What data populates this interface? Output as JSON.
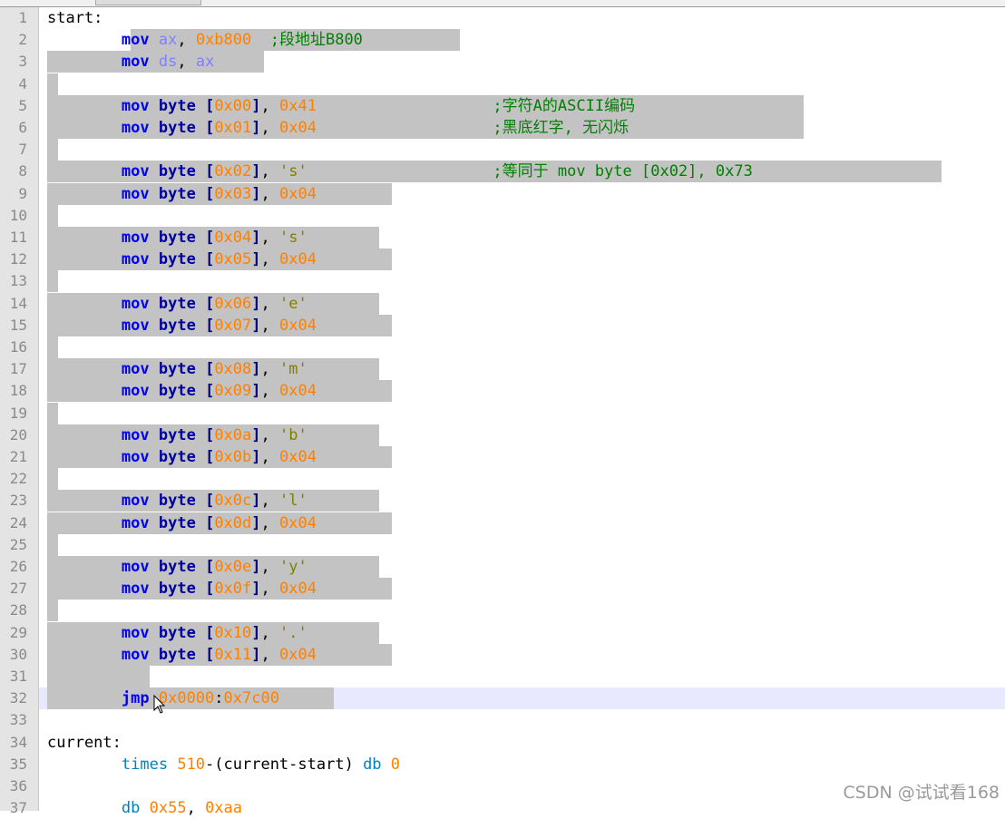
{
  "editor": {
    "lines": [
      {
        "n": "1",
        "tokens": [
          [
            "lbl",
            "start:"
          ]
        ]
      },
      {
        "n": "2",
        "tokens": [
          [
            "sp",
            "        "
          ],
          [
            "kw",
            "mov"
          ],
          [
            "sp",
            " "
          ],
          [
            "reg",
            "ax"
          ],
          [
            "plain",
            ", "
          ],
          [
            "num",
            "0xb800"
          ],
          [
            "sp",
            "  "
          ],
          [
            "cm",
            ";段地址B800"
          ]
        ]
      },
      {
        "n": "3",
        "tokens": [
          [
            "sp",
            "        "
          ],
          [
            "kw",
            "mov"
          ],
          [
            "sp",
            " "
          ],
          [
            "reg",
            "ds"
          ],
          [
            "plain",
            ", "
          ],
          [
            "reg",
            "ax"
          ]
        ]
      },
      {
        "n": "4",
        "tokens": []
      },
      {
        "n": "5",
        "tokens": [
          [
            "sp",
            "        "
          ],
          [
            "kw",
            "mov"
          ],
          [
            "sp",
            " "
          ],
          [
            "kw2",
            "byte"
          ],
          [
            "sp",
            " "
          ],
          [
            "br",
            "["
          ],
          [
            "num",
            "0x00"
          ],
          [
            "br",
            "]"
          ],
          [
            "plain",
            ", "
          ],
          [
            "num",
            "0x41"
          ],
          [
            "sp",
            "                   "
          ],
          [
            "cm",
            ";字符A的ASCII编码"
          ]
        ]
      },
      {
        "n": "6",
        "tokens": [
          [
            "sp",
            "        "
          ],
          [
            "kw",
            "mov"
          ],
          [
            "sp",
            " "
          ],
          [
            "kw2",
            "byte"
          ],
          [
            "sp",
            " "
          ],
          [
            "br",
            "["
          ],
          [
            "num",
            "0x01"
          ],
          [
            "br",
            "]"
          ],
          [
            "plain",
            ", "
          ],
          [
            "num",
            "0x04"
          ],
          [
            "sp",
            "                   "
          ],
          [
            "cm",
            ";黑底红字, 无闪烁"
          ]
        ]
      },
      {
        "n": "7",
        "tokens": []
      },
      {
        "n": "8",
        "tokens": [
          [
            "sp",
            "        "
          ],
          [
            "kw",
            "mov"
          ],
          [
            "sp",
            " "
          ],
          [
            "kw2",
            "byte"
          ],
          [
            "sp",
            " "
          ],
          [
            "br",
            "["
          ],
          [
            "num",
            "0x02"
          ],
          [
            "br",
            "]"
          ],
          [
            "plain",
            ", "
          ],
          [
            "str",
            "'s'"
          ],
          [
            "sp",
            "                    "
          ],
          [
            "cm",
            ";等同于 mov byte [0x02], 0x73"
          ]
        ]
      },
      {
        "n": "9",
        "tokens": [
          [
            "sp",
            "        "
          ],
          [
            "kw",
            "mov"
          ],
          [
            "sp",
            " "
          ],
          [
            "kw2",
            "byte"
          ],
          [
            "sp",
            " "
          ],
          [
            "br",
            "["
          ],
          [
            "num",
            "0x03"
          ],
          [
            "br",
            "]"
          ],
          [
            "plain",
            ", "
          ],
          [
            "num",
            "0x04"
          ]
        ]
      },
      {
        "n": "10",
        "tokens": []
      },
      {
        "n": "11",
        "tokens": [
          [
            "sp",
            "        "
          ],
          [
            "kw",
            "mov"
          ],
          [
            "sp",
            " "
          ],
          [
            "kw2",
            "byte"
          ],
          [
            "sp",
            " "
          ],
          [
            "br",
            "["
          ],
          [
            "num",
            "0x04"
          ],
          [
            "br",
            "]"
          ],
          [
            "plain",
            ", "
          ],
          [
            "str",
            "'s'"
          ]
        ]
      },
      {
        "n": "12",
        "tokens": [
          [
            "sp",
            "        "
          ],
          [
            "kw",
            "mov"
          ],
          [
            "sp",
            " "
          ],
          [
            "kw2",
            "byte"
          ],
          [
            "sp",
            " "
          ],
          [
            "br",
            "["
          ],
          [
            "num",
            "0x05"
          ],
          [
            "br",
            "]"
          ],
          [
            "plain",
            ", "
          ],
          [
            "num",
            "0x04"
          ]
        ]
      },
      {
        "n": "13",
        "tokens": []
      },
      {
        "n": "14",
        "tokens": [
          [
            "sp",
            "        "
          ],
          [
            "kw",
            "mov"
          ],
          [
            "sp",
            " "
          ],
          [
            "kw2",
            "byte"
          ],
          [
            "sp",
            " "
          ],
          [
            "br",
            "["
          ],
          [
            "num",
            "0x06"
          ],
          [
            "br",
            "]"
          ],
          [
            "plain",
            ", "
          ],
          [
            "str",
            "'e'"
          ]
        ]
      },
      {
        "n": "15",
        "tokens": [
          [
            "sp",
            "        "
          ],
          [
            "kw",
            "mov"
          ],
          [
            "sp",
            " "
          ],
          [
            "kw2",
            "byte"
          ],
          [
            "sp",
            " "
          ],
          [
            "br",
            "["
          ],
          [
            "num",
            "0x07"
          ],
          [
            "br",
            "]"
          ],
          [
            "plain",
            ", "
          ],
          [
            "num",
            "0x04"
          ]
        ]
      },
      {
        "n": "16",
        "tokens": []
      },
      {
        "n": "17",
        "tokens": [
          [
            "sp",
            "        "
          ],
          [
            "kw",
            "mov"
          ],
          [
            "sp",
            " "
          ],
          [
            "kw2",
            "byte"
          ],
          [
            "sp",
            " "
          ],
          [
            "br",
            "["
          ],
          [
            "num",
            "0x08"
          ],
          [
            "br",
            "]"
          ],
          [
            "plain",
            ", "
          ],
          [
            "str",
            "'m'"
          ]
        ]
      },
      {
        "n": "18",
        "tokens": [
          [
            "sp",
            "        "
          ],
          [
            "kw",
            "mov"
          ],
          [
            "sp",
            " "
          ],
          [
            "kw2",
            "byte"
          ],
          [
            "sp",
            " "
          ],
          [
            "br",
            "["
          ],
          [
            "num",
            "0x09"
          ],
          [
            "br",
            "]"
          ],
          [
            "plain",
            ", "
          ],
          [
            "num",
            "0x04"
          ]
        ]
      },
      {
        "n": "19",
        "tokens": []
      },
      {
        "n": "20",
        "tokens": [
          [
            "sp",
            "        "
          ],
          [
            "kw",
            "mov"
          ],
          [
            "sp",
            " "
          ],
          [
            "kw2",
            "byte"
          ],
          [
            "sp",
            " "
          ],
          [
            "br",
            "["
          ],
          [
            "num",
            "0x0a"
          ],
          [
            "br",
            "]"
          ],
          [
            "plain",
            ", "
          ],
          [
            "str",
            "'b'"
          ]
        ]
      },
      {
        "n": "21",
        "tokens": [
          [
            "sp",
            "        "
          ],
          [
            "kw",
            "mov"
          ],
          [
            "sp",
            " "
          ],
          [
            "kw2",
            "byte"
          ],
          [
            "sp",
            " "
          ],
          [
            "br",
            "["
          ],
          [
            "num",
            "0x0b"
          ],
          [
            "br",
            "]"
          ],
          [
            "plain",
            ", "
          ],
          [
            "num",
            "0x04"
          ]
        ]
      },
      {
        "n": "22",
        "tokens": []
      },
      {
        "n": "23",
        "tokens": [
          [
            "sp",
            "        "
          ],
          [
            "kw",
            "mov"
          ],
          [
            "sp",
            " "
          ],
          [
            "kw2",
            "byte"
          ],
          [
            "sp",
            " "
          ],
          [
            "br",
            "["
          ],
          [
            "num",
            "0x0c"
          ],
          [
            "br",
            "]"
          ],
          [
            "plain",
            ", "
          ],
          [
            "str",
            "'l'"
          ]
        ]
      },
      {
        "n": "24",
        "tokens": [
          [
            "sp",
            "        "
          ],
          [
            "kw",
            "mov"
          ],
          [
            "sp",
            " "
          ],
          [
            "kw2",
            "byte"
          ],
          [
            "sp",
            " "
          ],
          [
            "br",
            "["
          ],
          [
            "num",
            "0x0d"
          ],
          [
            "br",
            "]"
          ],
          [
            "plain",
            ", "
          ],
          [
            "num",
            "0x04"
          ]
        ]
      },
      {
        "n": "25",
        "tokens": []
      },
      {
        "n": "26",
        "tokens": [
          [
            "sp",
            "        "
          ],
          [
            "kw",
            "mov"
          ],
          [
            "sp",
            " "
          ],
          [
            "kw2",
            "byte"
          ],
          [
            "sp",
            " "
          ],
          [
            "br",
            "["
          ],
          [
            "num",
            "0x0e"
          ],
          [
            "br",
            "]"
          ],
          [
            "plain",
            ", "
          ],
          [
            "str",
            "'y'"
          ]
        ]
      },
      {
        "n": "27",
        "tokens": [
          [
            "sp",
            "        "
          ],
          [
            "kw",
            "mov"
          ],
          [
            "sp",
            " "
          ],
          [
            "kw2",
            "byte"
          ],
          [
            "sp",
            " "
          ],
          [
            "br",
            "["
          ],
          [
            "num",
            "0x0f"
          ],
          [
            "br",
            "]"
          ],
          [
            "plain",
            ", "
          ],
          [
            "num",
            "0x04"
          ]
        ]
      },
      {
        "n": "28",
        "tokens": []
      },
      {
        "n": "29",
        "tokens": [
          [
            "sp",
            "        "
          ],
          [
            "kw",
            "mov"
          ],
          [
            "sp",
            " "
          ],
          [
            "kw2",
            "byte"
          ],
          [
            "sp",
            " "
          ],
          [
            "br",
            "["
          ],
          [
            "num",
            "0x10"
          ],
          [
            "br",
            "]"
          ],
          [
            "plain",
            ", "
          ],
          [
            "str",
            "'.'"
          ]
        ]
      },
      {
        "n": "30",
        "tokens": [
          [
            "sp",
            "        "
          ],
          [
            "kw",
            "mov"
          ],
          [
            "sp",
            " "
          ],
          [
            "kw2",
            "byte"
          ],
          [
            "sp",
            " "
          ],
          [
            "br",
            "["
          ],
          [
            "num",
            "0x11"
          ],
          [
            "br",
            "]"
          ],
          [
            "plain",
            ", "
          ],
          [
            "num",
            "0x04"
          ]
        ]
      },
      {
        "n": "31",
        "tokens": []
      },
      {
        "n": "32",
        "tokens": [
          [
            "sp",
            "        "
          ],
          [
            "kw",
            "jmp"
          ],
          [
            "sp",
            " "
          ],
          [
            "num",
            "0x0000"
          ],
          [
            "plain",
            ":"
          ],
          [
            "num",
            "0x7c00"
          ]
        ]
      },
      {
        "n": "33",
        "tokens": []
      },
      {
        "n": "34",
        "tokens": [
          [
            "lbl",
            "current:"
          ]
        ]
      },
      {
        "n": "35",
        "tokens": [
          [
            "sp",
            "        "
          ],
          [
            "dir",
            "times"
          ],
          [
            "sp",
            " "
          ],
          [
            "num",
            "510"
          ],
          [
            "plain",
            "-(current-start)"
          ],
          [
            "sp",
            " "
          ],
          [
            "dir",
            "db"
          ],
          [
            "sp",
            " "
          ],
          [
            "num",
            "0"
          ]
        ]
      },
      {
        "n": "36",
        "tokens": []
      },
      {
        "n": "37",
        "tokens": [
          [
            "sp",
            "        "
          ],
          [
            "dir",
            "db"
          ],
          [
            "sp",
            " "
          ],
          [
            "num",
            "0x55"
          ],
          [
            "plain",
            ", "
          ],
          [
            "num",
            "0xaa"
          ]
        ]
      }
    ]
  },
  "watermark": "CSDN @试试看168",
  "icons": {
    "cursor": "mouse-pointer-icon"
  }
}
